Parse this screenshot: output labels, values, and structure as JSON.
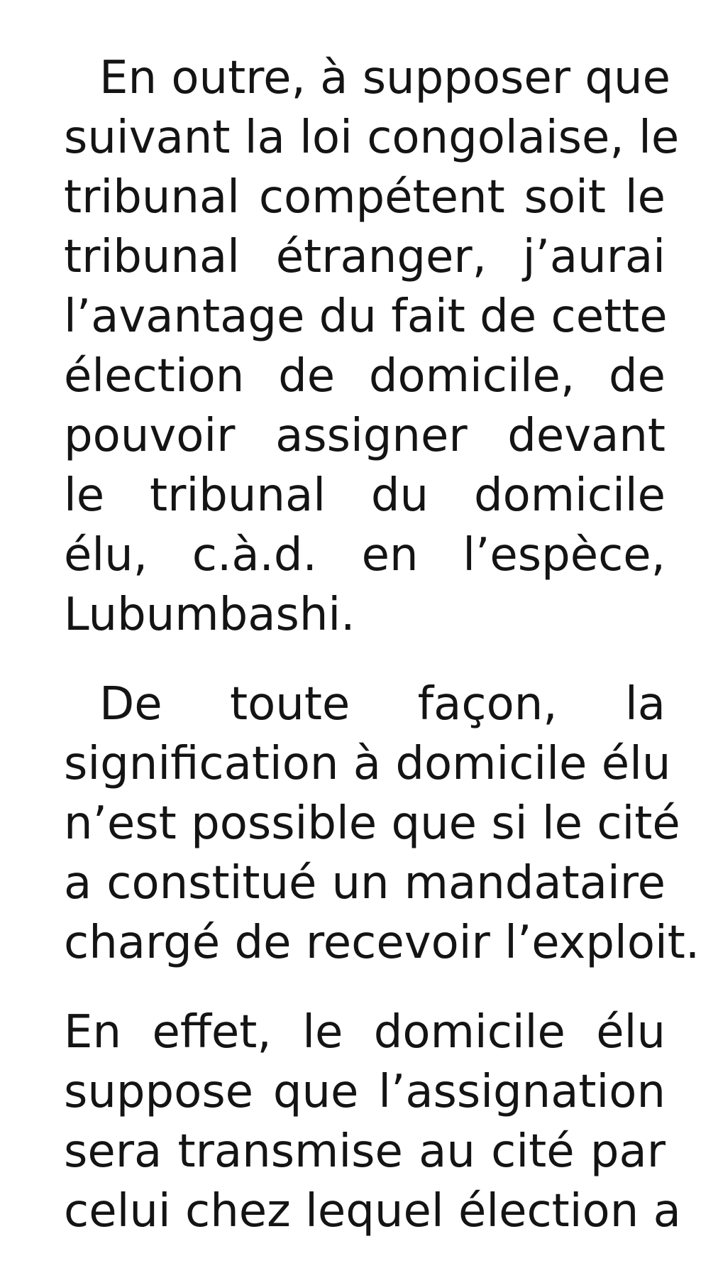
{
  "paragraphs": [
    {
      "lines": [
        "En outre, à supposer que",
        "suivant la loi congolaise, le",
        "tribunal compétent soit le",
        "tribunal étranger, j’aurai",
        "l’avantage du fait de  cette",
        "élection de domicile, de",
        "pouvoir assigner devant",
        "le tribunal du domicile",
        "élu, c.à.d. en l’espèce,",
        "Lubumbashi."
      ]
    },
    {
      "lines": [
        "De toute façon, la",
        "signification à domicile élu",
        "n’est possible que si le cité",
        "a constitué un mandataire",
        "chargé de recevoir l’exploit."
      ]
    },
    {
      "lines": [
        "En effet, le domicile élu",
        "suppose que l’assignation",
        "sera transmise au cité par",
        "celui chez lequel élection a"
      ]
    }
  ]
}
